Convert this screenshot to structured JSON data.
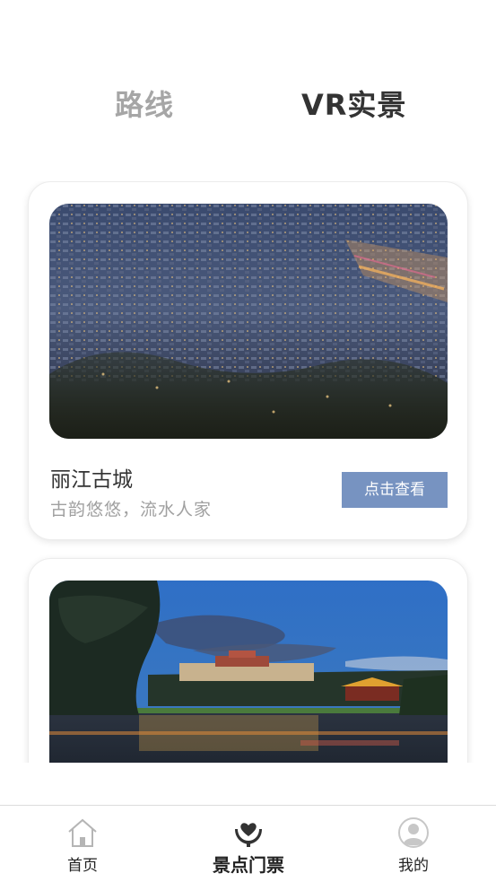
{
  "tabs": {
    "route_label": "路线",
    "vr_label": "VR实景"
  },
  "cards": [
    {
      "title": "丽江古城",
      "subtitle": "古韵悠悠，流水人家",
      "button_label": "点击查看"
    },
    {
      "title": "",
      "subtitle": "",
      "button_label": ""
    }
  ],
  "bottom_nav": {
    "items": [
      {
        "label": "首页",
        "icon": "home-icon"
      },
      {
        "label": "景点门票",
        "icon": "heart-hands-icon",
        "active": true
      },
      {
        "label": "我的",
        "icon": "user-avatar-icon"
      }
    ]
  },
  "colors": {
    "active_text": "#333333",
    "inactive_text": "#a6a6a6",
    "button_bg": "#7793c1",
    "subtitle_text": "#a0a0a0"
  }
}
